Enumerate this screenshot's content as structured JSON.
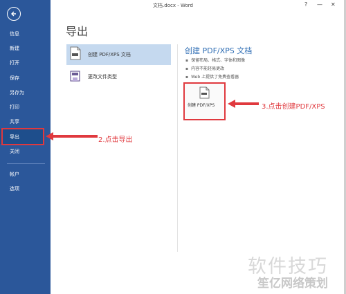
{
  "window": {
    "title": "文档.docx - Word",
    "help": "?",
    "minimize": "—",
    "close": "✕"
  },
  "sidebar": {
    "items": [
      {
        "label": "信息"
      },
      {
        "label": "新建"
      },
      {
        "label": "打开"
      },
      {
        "label": "保存"
      },
      {
        "label": "另存为"
      },
      {
        "label": "打印"
      },
      {
        "label": "共享"
      },
      {
        "label": "导出"
      },
      {
        "label": "关闭"
      },
      {
        "label": "帐户"
      },
      {
        "label": "选项"
      }
    ]
  },
  "main": {
    "title": "导出",
    "options": [
      {
        "label": "创建 PDF/XPS 文档"
      },
      {
        "label": "更改文件类型"
      }
    ],
    "pdf_panel": {
      "title": "创建 PDF/XPS 文档",
      "bullets": [
        "保留布局、格式、字体和图像",
        "内容不能轻易更改",
        "Web 上提供了免费查看器"
      ],
      "button_label": "创建 PDF/XPS"
    }
  },
  "annotations": {
    "step2": "2.点击导出",
    "step3": "3.点击创建PDF/XPS"
  },
  "watermark": {
    "line1": "软件技巧",
    "line2": "笙亿网络策划"
  },
  "colors": {
    "sidebar": "#2b579a",
    "accent_red": "#e0393e",
    "highlight": "#c5d9ef"
  }
}
